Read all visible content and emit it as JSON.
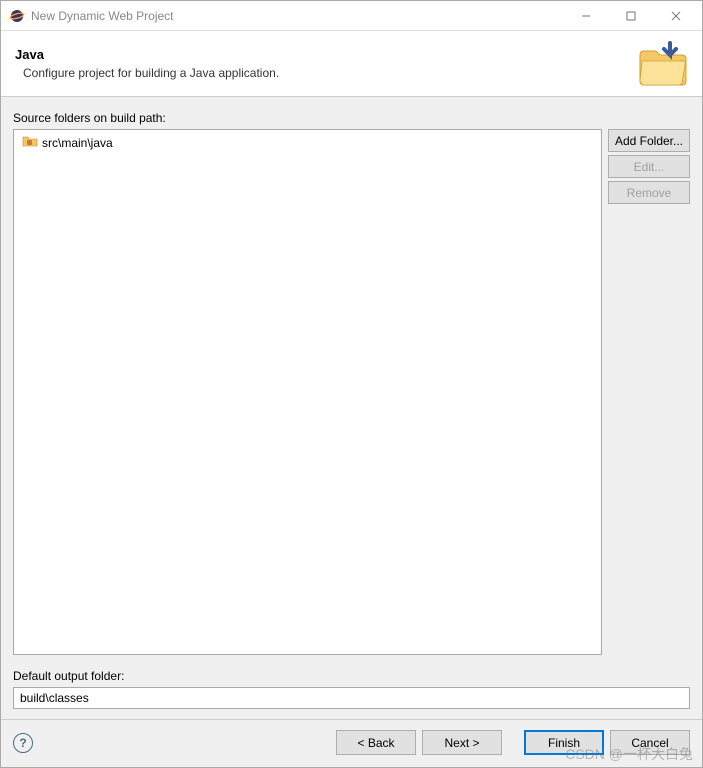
{
  "window": {
    "title": "New Dynamic Web Project"
  },
  "banner": {
    "title": "Java",
    "description": "Configure project for building a Java application."
  },
  "labels": {
    "sourceFolders": "Source folders on build path:",
    "defaultOutput": "Default output folder:"
  },
  "sourceTree": {
    "items": [
      {
        "path": "src\\main\\java"
      }
    ]
  },
  "sideButtons": {
    "addFolder": "Add Folder...",
    "edit": "Edit...",
    "remove": "Remove"
  },
  "outputFolder": {
    "value": "build\\classes"
  },
  "navButtons": {
    "back": "< Back",
    "next": "Next >",
    "finish": "Finish",
    "cancel": "Cancel"
  },
  "watermark": "CSDN @一杯大白兔"
}
